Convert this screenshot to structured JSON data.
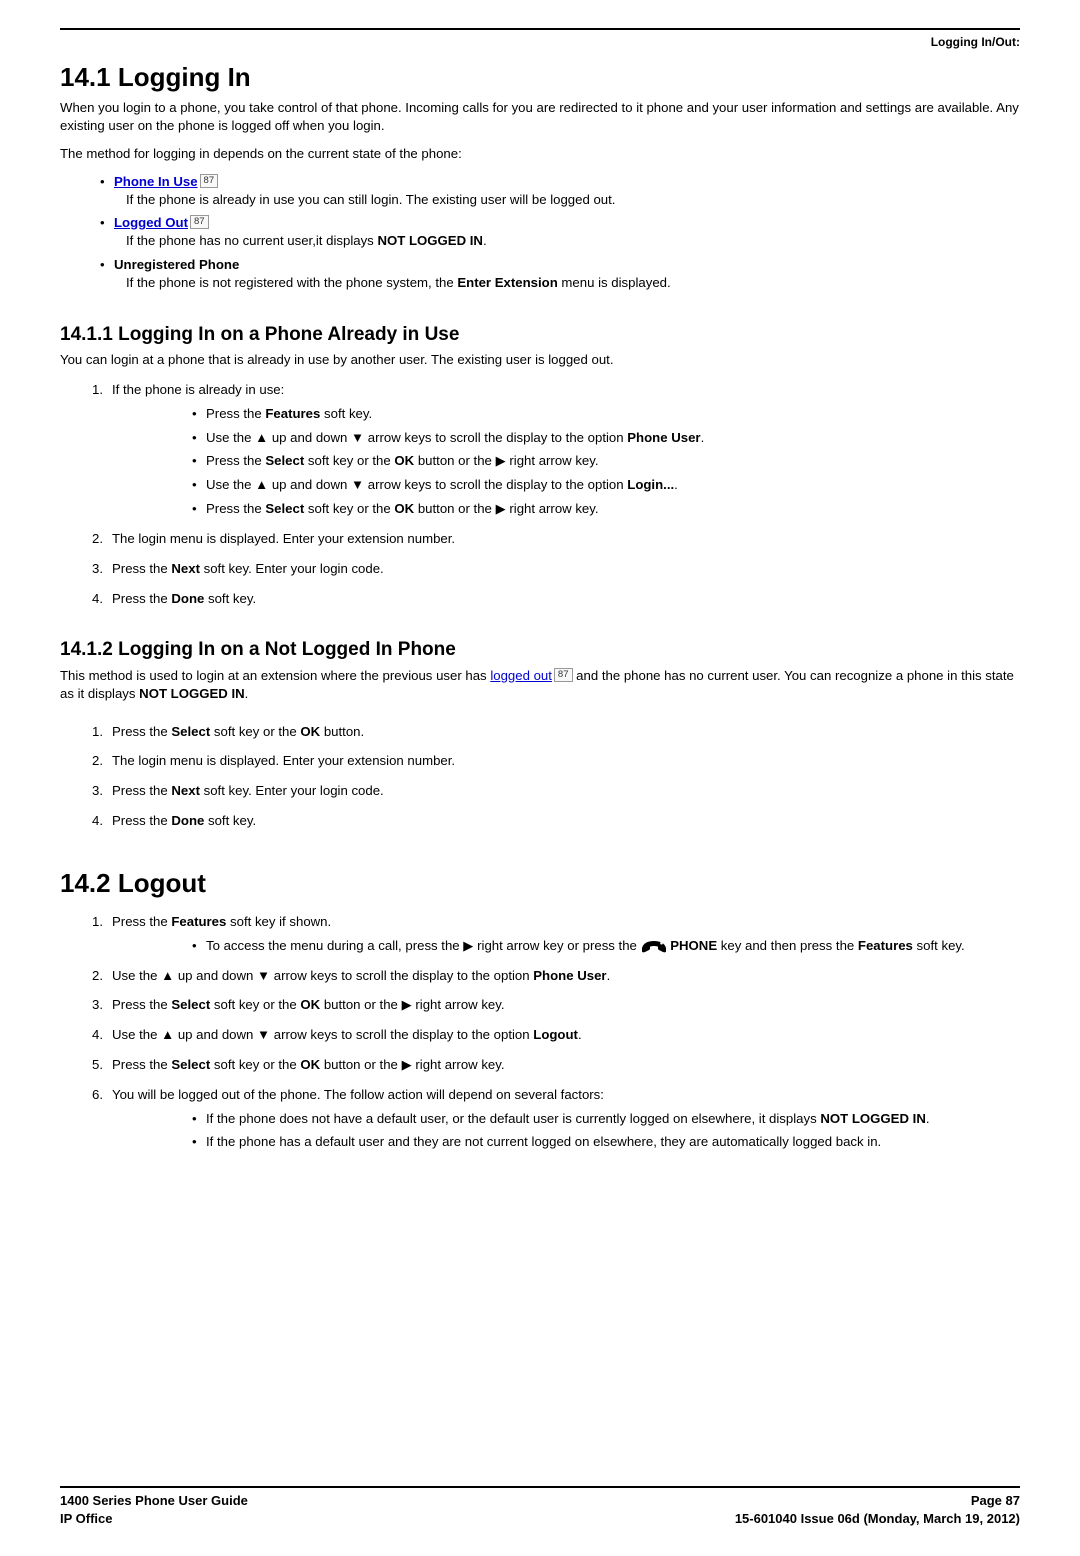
{
  "meta": {
    "topRight": "Logging In/Out:",
    "footer": {
      "leftTop": "1400 Series Phone User Guide",
      "leftBottom": "IP Office",
      "rightTop": "Page 87",
      "rightBottom": "15-601040 Issue 06d (Monday, March 19, 2012)"
    }
  },
  "s14_1": {
    "heading": "14.1 Logging In",
    "intro": "When you login to a phone, you take control of that phone. Incoming calls for you are redirected to it phone and your user information and settings are available. Any existing user on the phone is logged off when you login.",
    "methodLine": "The method for logging in depends on the current state of the phone:",
    "items": [
      {
        "link": "Phone In Use",
        "ref": "87",
        "desc": "If the phone is already in use you can still login. The existing user will be logged out."
      },
      {
        "link": "Logged Out",
        "ref": "87",
        "descPrefix": "If the phone has no current user,it displays ",
        "descBold": "NOT LOGGED IN",
        "descSuffix": "."
      },
      {
        "boldTitle": "Unregistered Phone",
        "descPrefix": "If the phone is not registered with the phone system, the ",
        "descBold": "Enter Extension",
        "descSuffix": " menu is displayed."
      }
    ]
  },
  "s14_1_1": {
    "heading": "14.1.1 Logging In on a Phone Already in Use",
    "intro": "You can login at a phone that is already in use by another user. The existing user is logged out.",
    "step1": "If the phone is already in use:",
    "bullets": {
      "b1_pre": "Press the ",
      "b1_bold": "Features",
      "b1_suf": " soft key.",
      "b2_pre": "Use the ",
      "b2_mid": " up and down ",
      "b2_mid2": " arrow keys to scroll the display to the option ",
      "b2_bold": "Phone User",
      "b2_suf": ".",
      "b3_pre": "Press the ",
      "b3_b1": "Select",
      "b3_mid1": " soft key or the ",
      "b3_b2": "OK",
      "b3_mid2": " button or the ",
      "b3_suf": " right arrow key.",
      "b4_pre": "Use the ",
      "b4_mid": " up and down ",
      "b4_mid2": " arrow keys to scroll the display to the option ",
      "b4_bold": "Login...",
      "b4_suf": ".",
      "b5_pre": "Press the ",
      "b5_b1": "Select",
      "b5_mid1": " soft key or the ",
      "b5_b2": "OK",
      "b5_mid2": " button or the ",
      "b5_suf": " right arrow key."
    },
    "step2": "The login menu is displayed. Enter your extension number.",
    "step3_pre": "Press the ",
    "step3_bold": "Next",
    "step3_suf": " soft key. Enter your login code.",
    "step4_pre": "Press the ",
    "step4_bold": "Done",
    "step4_suf": " soft key."
  },
  "s14_1_2": {
    "heading": "14.1.2 Logging In on a Not Logged In Phone",
    "intro_pre": "This method is used to login at an extension where the previous user has ",
    "intro_link": "logged out",
    "intro_ref": "87",
    "intro_mid": " and the phone has no current user. You can recognize a phone in this state as it displays ",
    "intro_bold": "NOT LOGGED IN",
    "intro_suf": ".",
    "step1_pre": "Press the ",
    "step1_b1": "Select",
    "step1_mid": " soft key or the ",
    "step1_b2": "OK",
    "step1_suf": " button.",
    "step2": "The login menu is displayed. Enter your extension number.",
    "step3_pre": "Press the ",
    "step3_bold": "Next",
    "step3_suf": " soft key. Enter your login code.",
    "step4_pre": "Press the ",
    "step4_bold": "Done",
    "step4_suf": " soft key."
  },
  "s14_2": {
    "heading": "14.2 Logout",
    "step1_pre": "Press the ",
    "step1_bold": "Features",
    "step1_suf": " soft key if shown.",
    "step1b_pre": "To access the menu during a call, press the ",
    "step1b_mid": " right arrow key or press the ",
    "step1b_bold": "PHONE",
    "step1b_mid2": " key and then press the ",
    "step1b_bold2": "Features",
    "step1b_suf": " soft key.",
    "step2_pre": "Use the ",
    "step2_mid": " up and down ",
    "step2_mid2": " arrow keys to scroll the display to the option ",
    "step2_bold": "Phone User",
    "step2_suf": ".",
    "step3_pre": "Press the ",
    "step3_b1": "Select",
    "step3_mid1": " soft key or the ",
    "step3_b2": "OK",
    "step3_mid2": " button or the ",
    "step3_suf": " right arrow key.",
    "step4_pre": "Use the ",
    "step4_mid": " up and down ",
    "step4_mid2": " arrow keys to scroll the display to the option ",
    "step4_bold": "Logout",
    "step4_suf": ".",
    "step5_pre": "Press the ",
    "step5_b1": "Select",
    "step5_mid1": " soft key or the ",
    "step5_b2": "OK",
    "step5_mid2": " button or the ",
    "step5_suf": " right arrow key.",
    "step6": "You will be logged out of the phone. The follow action will depend on several factors:",
    "step6b1_pre": "If the phone does not have a default user, or the default user is currently logged on elsewhere, it displays ",
    "step6b1_bold": "NOT LOGGED IN",
    "step6b1_suf": ".",
    "step6b2": "If the phone has a default user and they are not current logged on elsewhere, they are automatically logged back in."
  }
}
